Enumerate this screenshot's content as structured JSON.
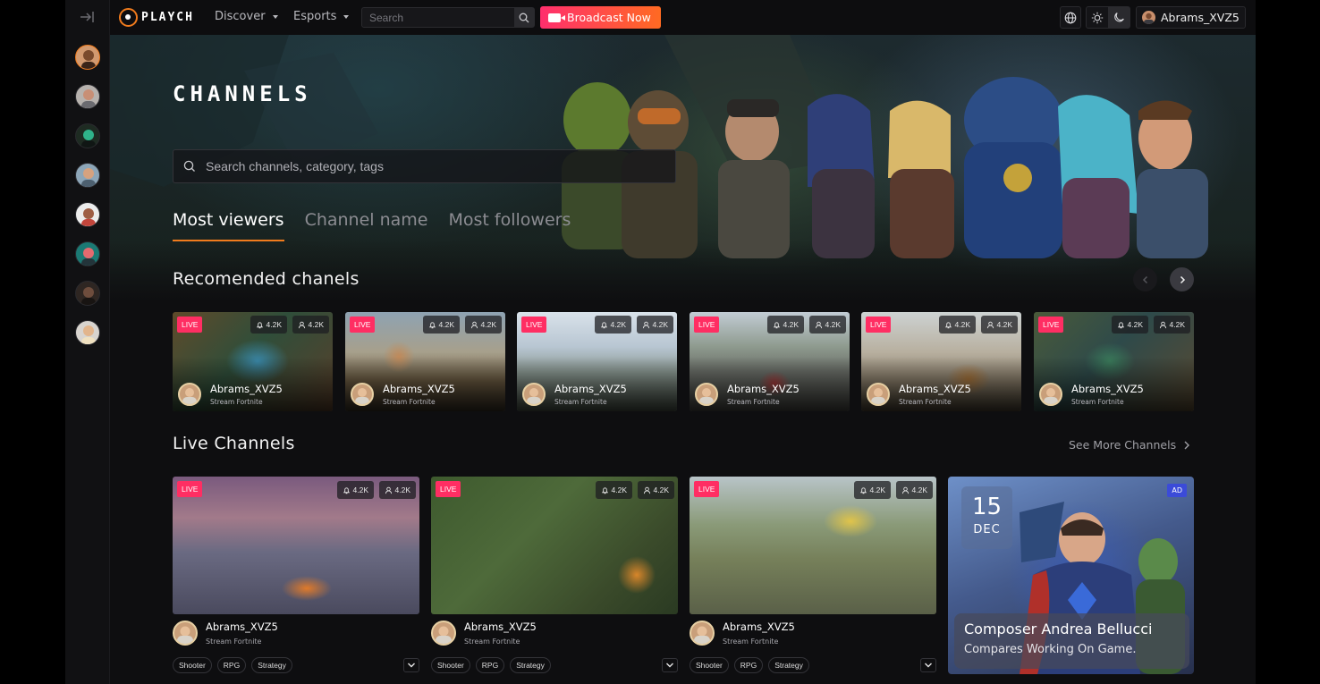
{
  "app": {
    "logo_text": "PLAYCH"
  },
  "nav": {
    "discover": "Discover",
    "esports": "Esports"
  },
  "search": {
    "placeholder": "Search"
  },
  "broadcast": {
    "label": "Broadcast Now"
  },
  "user": {
    "name": "Abrams_XVZ5"
  },
  "colors": {
    "accent": "#f07b1d",
    "live": "#ff2e63",
    "broadcast_start": "#ff2f6d",
    "broadcast_end": "#ff6a22"
  },
  "sidebar": {
    "avatars": [
      "avatar-1",
      "avatar-2",
      "avatar-3",
      "avatar-4",
      "avatar-5",
      "avatar-6",
      "avatar-7",
      "avatar-8"
    ]
  },
  "hero": {
    "title": "CHANNELS",
    "search_placeholder": "Search channels, category, tags",
    "tabs": [
      "Most viewers",
      "Channel name",
      "Most followers"
    ],
    "active_tab": "Most viewers"
  },
  "recommended": {
    "title": "Recomended chanels",
    "cards": [
      {
        "badge": "LIVE",
        "notify": "4.2K",
        "viewers": "4.2K",
        "name": "Abrams_XVZ5",
        "subtitle": "Stream Fortnite"
      },
      {
        "badge": "LIVE",
        "notify": "4.2K",
        "viewers": "4.2K",
        "name": "Abrams_XVZ5",
        "subtitle": "Stream Fortnite"
      },
      {
        "badge": "LIVE",
        "notify": "4.2K",
        "viewers": "4.2K",
        "name": "Abrams_XVZ5",
        "subtitle": "Stream Fortnite"
      },
      {
        "badge": "LIVE",
        "notify": "4.2K",
        "viewers": "4.2K",
        "name": "Abrams_XVZ5",
        "subtitle": "Stream Fortnite"
      },
      {
        "badge": "LIVE",
        "notify": "4.2K",
        "viewers": "4.2K",
        "name": "Abrams_XVZ5",
        "subtitle": "Stream Fortnite"
      },
      {
        "badge": "LIVE",
        "notify": "4.2K",
        "viewers": "4.2K",
        "name": "Abrams_XVZ5",
        "subtitle": "Stream Fortnite"
      }
    ]
  },
  "live": {
    "title": "Live Channels",
    "see_more": "See More Channels",
    "cards": [
      {
        "badge": "LIVE",
        "notify": "4.2K",
        "viewers": "4.2K",
        "name": "Abrams_XVZ5",
        "subtitle": "Stream Fortnite",
        "tags": [
          "Shooter",
          "RPG",
          "Strategy"
        ]
      },
      {
        "badge": "LIVE",
        "notify": "4.2K",
        "viewers": "4.2K",
        "name": "Abrams_XVZ5",
        "subtitle": "Stream Fortnite",
        "tags": [
          "Shooter",
          "RPG",
          "Strategy"
        ]
      },
      {
        "badge": "LIVE",
        "notify": "4.2K",
        "viewers": "4.2K",
        "name": "Abrams_XVZ5",
        "subtitle": "Stream Fortnite",
        "tags": [
          "Shooter",
          "RPG",
          "Strategy"
        ]
      }
    ]
  },
  "ad": {
    "day": "15",
    "month": "DEC",
    "badge": "AD",
    "title": "Composer Andrea Bellucci",
    "subtitle": "Compares Working On Game."
  },
  "icons": {
    "rail_toggle": "sidebar-expand-icon",
    "search": "search-icon",
    "camera": "video-camera-icon",
    "language": "globe-icon",
    "light": "sun-icon",
    "dark": "moon-icon",
    "notify": "bell-icon",
    "viewers": "user-icon",
    "prev": "chevron-left-icon",
    "next": "chevron-right-icon",
    "expand": "chevron-down-icon"
  }
}
